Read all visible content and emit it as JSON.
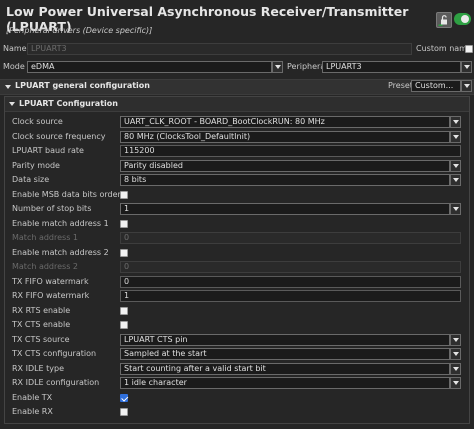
{
  "header": {
    "title": "Low Power Universal Asynchronous Receiver/Transmitter (LPUART)",
    "subtitle": "[Peripheral drivers (Device specific)]"
  },
  "top": {
    "name_label": "Name",
    "name_value": "LPUART3",
    "custom_name_label": "Custom name",
    "mode_label": "Mode",
    "mode_value": "eDMA",
    "peripheral_label": "Peripheral",
    "peripheral_value": "LPUART3"
  },
  "general": {
    "title": "LPUART general configuration",
    "preset_label": "Preset",
    "preset_value": "Custom..."
  },
  "config": {
    "title": "LPUART Configuration",
    "rows": [
      {
        "label": "Clock source",
        "type": "select",
        "value": "UART_CLK_ROOT - BOARD_BootClockRUN: 80 MHz",
        "enabled": true
      },
      {
        "label": "Clock source frequency",
        "type": "select",
        "value": "80 MHz (ClocksTool_DefaultInit)",
        "enabled": true
      },
      {
        "label": "LPUART baud rate",
        "type": "input",
        "value": "115200",
        "enabled": true
      },
      {
        "label": "Parity mode",
        "type": "select",
        "value": "Parity disabled",
        "enabled": true
      },
      {
        "label": "Data size",
        "type": "select",
        "value": "8 bits",
        "enabled": true
      },
      {
        "label": "Enable MSB data bits order",
        "type": "checkbox",
        "checked": false,
        "enabled": true
      },
      {
        "label": "Number of stop bits",
        "type": "select",
        "value": "1",
        "enabled": true
      },
      {
        "label": "Enable match address 1",
        "type": "checkbox",
        "checked": false,
        "enabled": true
      },
      {
        "label": "Match address 1",
        "type": "input",
        "value": "0",
        "enabled": false
      },
      {
        "label": "Enable match address 2",
        "type": "checkbox",
        "checked": false,
        "enabled": true
      },
      {
        "label": "Match address 2",
        "type": "input",
        "value": "0",
        "enabled": false
      },
      {
        "label": "TX FIFO watermark",
        "type": "input",
        "value": "0",
        "enabled": true
      },
      {
        "label": "RX FIFO watermark",
        "type": "input",
        "value": "1",
        "enabled": true
      },
      {
        "label": "RX RTS enable",
        "type": "checkbox",
        "checked": false,
        "enabled": true
      },
      {
        "label": "TX CTS enable",
        "type": "checkbox",
        "checked": false,
        "enabled": true
      },
      {
        "label": "TX CTS source",
        "type": "select",
        "value": "LPUART CTS pin",
        "enabled": true
      },
      {
        "label": "TX CTS configuration",
        "type": "select",
        "value": "Sampled at the start",
        "enabled": true
      },
      {
        "label": "RX IDLE type",
        "type": "select",
        "value": "Start counting after a valid start bit",
        "enabled": true
      },
      {
        "label": "RX IDLE configuration",
        "type": "select",
        "value": "1 idle character",
        "enabled": true
      },
      {
        "label": "Enable TX",
        "type": "checkbox",
        "checked": true,
        "enabled": true
      },
      {
        "label": "Enable RX",
        "type": "checkbox",
        "checked": false,
        "enabled": true
      }
    ]
  },
  "colors": {
    "background": "#262626",
    "toggle_on": "#2ea043",
    "checkbox_checked": "#2f6fdc"
  },
  "icons": [
    "unlock-icon",
    "enable-toggle",
    "chevron-down-icon"
  ]
}
